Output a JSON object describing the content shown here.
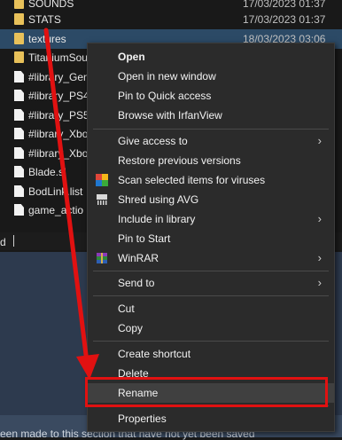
{
  "files": [
    {
      "name": "SOUNDS",
      "date": "17/03/2023 01:37",
      "type": "folder"
    },
    {
      "name": "STATS",
      "date": "17/03/2023 01:37",
      "type": "folder"
    },
    {
      "name": "textures",
      "date": "18/03/2023 03:06",
      "type": "folder",
      "selected": true
    },
    {
      "name": "TitaniumSou",
      "date": "",
      "type": "folder"
    },
    {
      "name": "#library_Gen",
      "date": "",
      "type": "file"
    },
    {
      "name": "#library_PS4",
      "date": "",
      "type": "file"
    },
    {
      "name": "#library_PS5",
      "date": "",
      "type": "file"
    },
    {
      "name": "#library_Xbo",
      "date": "",
      "type": "file"
    },
    {
      "name": "#library_Xbo",
      "date": "",
      "type": "file"
    },
    {
      "name": "Blade.sl",
      "date": "",
      "type": "file"
    },
    {
      "name": "BodLink.list",
      "date": "",
      "type": "file"
    },
    {
      "name": "game_actio",
      "date": "",
      "type": "file"
    }
  ],
  "statusbar": {
    "text": "d"
  },
  "notice": {
    "text": "een made to this section that have not yet been saved"
  },
  "context_menu": {
    "open": "Open",
    "open_new_window": "Open in new window",
    "pin_quick_access": "Pin to Quick access",
    "browse_irfanview": "Browse with IrfanView",
    "give_access": "Give access to",
    "restore_versions": "Restore previous versions",
    "scan_viruses": "Scan selected items for viruses",
    "shred_avg": "Shred using AVG",
    "include_library": "Include in library",
    "pin_start": "Pin to Start",
    "winrar": "WinRAR",
    "send_to": "Send to",
    "cut": "Cut",
    "copy": "Copy",
    "create_shortcut": "Create shortcut",
    "delete": "Delete",
    "rename": "Rename",
    "properties": "Properties",
    "submenu_arrow": "›"
  },
  "colors": {
    "annotation": "#e11111",
    "menu_bg": "#2b2b2b",
    "selection": "#2c4a66"
  }
}
